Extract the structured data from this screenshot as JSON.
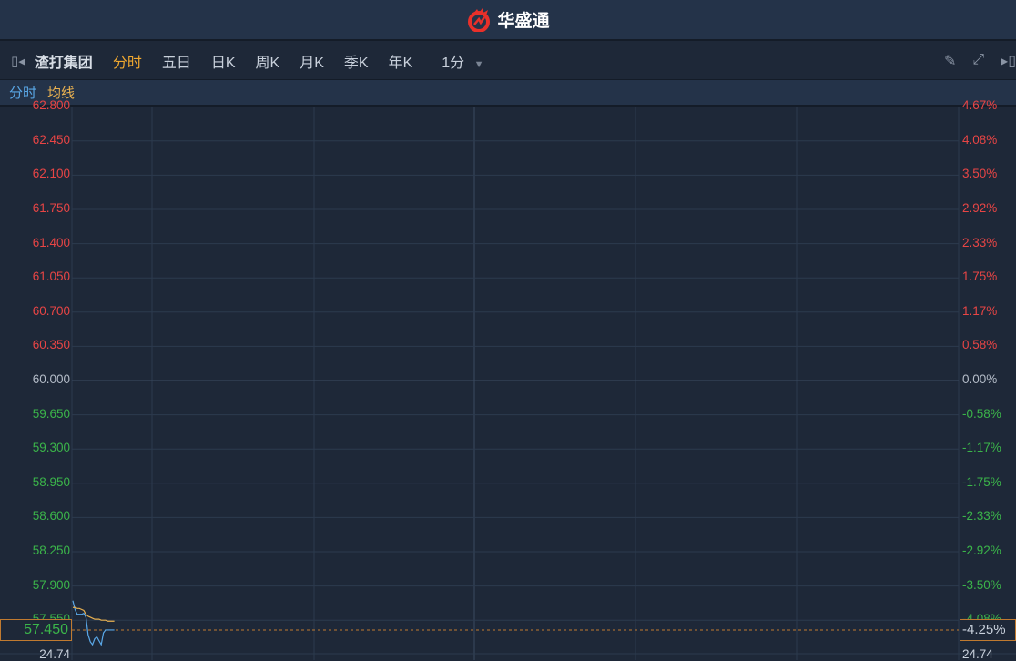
{
  "header": {
    "brand": "华盛通"
  },
  "toolbar": {
    "stock_name": "渣打集团",
    "tabs": [
      "分时",
      "五日",
      "日K",
      "周K",
      "月K",
      "季K",
      "年K"
    ],
    "active_tab": "分时",
    "interval": "1分"
  },
  "legend": {
    "price_label": "分时",
    "avg_label": "均线"
  },
  "colors": {
    "up": "#e84545",
    "down": "#3bb54a",
    "flat": "#b4bcc8",
    "price_line": "#5aa8e8",
    "avg_line": "#e8b050",
    "accent": "#c07a30"
  },
  "chart_data": {
    "type": "line",
    "base_price": 60.0,
    "left_ticks": [
      "62.800",
      "62.450",
      "62.100",
      "61.750",
      "61.400",
      "61.050",
      "60.700",
      "60.350",
      "60.000",
      "59.650",
      "59.300",
      "58.950",
      "58.600",
      "58.250",
      "57.900",
      "57.550"
    ],
    "right_ticks": [
      "4.67%",
      "4.08%",
      "3.50%",
      "2.92%",
      "2.33%",
      "1.75%",
      "1.17%",
      "0.58%",
      "0.00%",
      "-0.58%",
      "-1.17%",
      "-1.75%",
      "-2.33%",
      "-2.92%",
      "-3.50%",
      "-4.08%"
    ],
    "ylim": [
      57.45,
      62.8
    ],
    "current_price": "57.450",
    "current_pct": "-4.25%",
    "volume_left": "24.74",
    "volume_right": "24.74",
    "series": [
      {
        "name": "分时",
        "values": [
          57.75,
          57.66,
          57.61,
          57.61,
          57.61,
          57.62,
          57.58,
          57.4,
          57.33,
          57.3,
          57.36,
          57.38,
          57.34,
          57.3,
          57.42,
          57.45,
          57.45,
          57.45,
          57.45,
          57.45
        ]
      },
      {
        "name": "均线",
        "values": [
          57.68,
          57.68,
          57.67,
          57.67,
          57.66,
          57.65,
          57.61,
          57.59,
          57.58,
          57.57,
          57.56,
          57.56,
          57.56,
          57.55,
          57.55,
          57.55,
          57.54,
          57.54,
          57.54,
          57.54
        ]
      }
    ]
  }
}
